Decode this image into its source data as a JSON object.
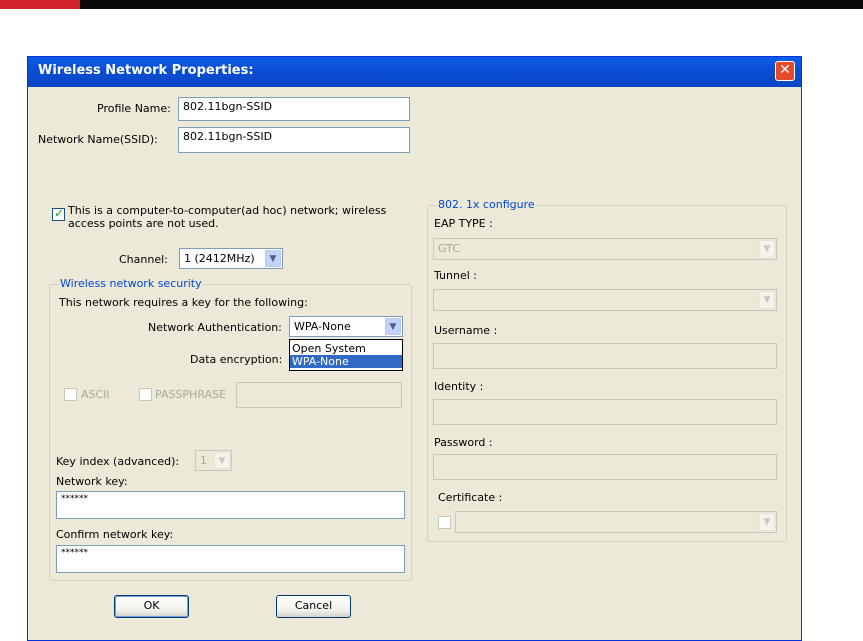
{
  "dialog": {
    "title": "Wireless Network Properties:",
    "close_glyph": "✕"
  },
  "profile": {
    "profile_name_label": "Profile Name:",
    "profile_name_value": "802.11bgn-SSID",
    "ssid_label": "Network Name(SSID):",
    "ssid_value": "802.11bgn-SSID"
  },
  "adhoc": {
    "checked": true,
    "label_line1": "This is a computer-to-computer(ad hoc) network; wireless",
    "label_line2": "access points are not used."
  },
  "channel": {
    "label": "Channel:",
    "value": "1  (2412MHz)"
  },
  "security": {
    "legend": "Wireless network security",
    "requires_text": "This network requires a key for the following:",
    "auth_label": "Network Authentication:",
    "auth_value": "WPA-None",
    "auth_options": [
      "Open System",
      "WPA-None"
    ],
    "encryption_label": "Data encryption:",
    "ascii_label": "ASCII",
    "passphrase_label": "PASSPHRASE",
    "key_index_label": "Key index (advanced):",
    "key_index_value": "1",
    "network_key_label": "Network key:",
    "network_key_value": "******",
    "confirm_key_label": "Confirm network key:",
    "confirm_key_value": "******"
  },
  "eap": {
    "legend": "802. 1x configure",
    "eap_type_label": "EAP TYPE :",
    "eap_type_value": "GTC",
    "tunnel_label": "Tunnel :",
    "username_label": "Username :",
    "identity_label": "Identity :",
    "password_label": "Password :",
    "certificate_label": "Certificate :"
  },
  "buttons": {
    "ok": "OK",
    "cancel": "Cancel"
  },
  "colors": {
    "titlebar": "#0b4ed6",
    "legend_text": "#0046d5",
    "dialog_bg": "#ece9d8",
    "selection": "#316ac5"
  }
}
